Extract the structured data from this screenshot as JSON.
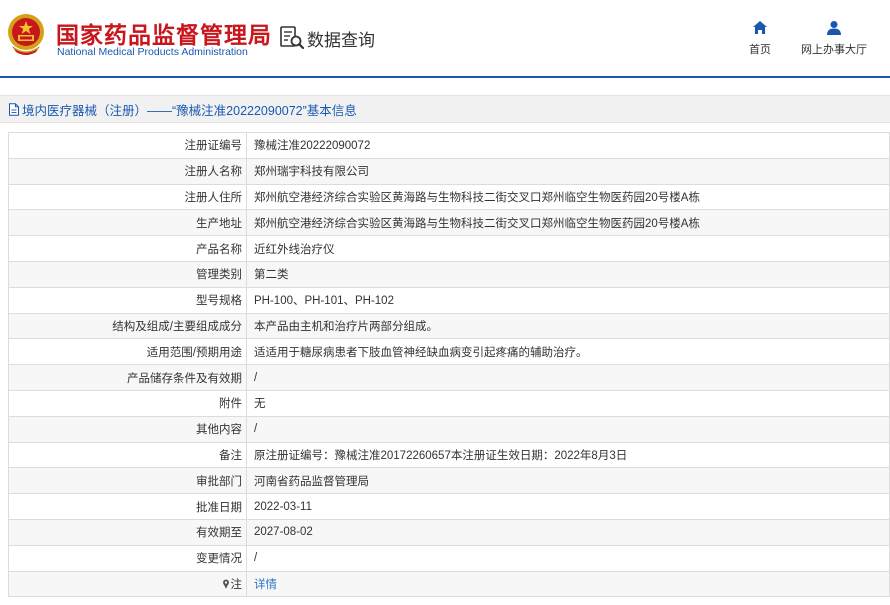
{
  "header": {
    "org_cn": "国家药品监督管理局",
    "org_en": "National Medical Products Administration",
    "query_label": "数据查询",
    "nav": [
      {
        "label": "首页",
        "icon": "home-icon"
      },
      {
        "label": "网上办事大厅",
        "icon": "user-icon"
      }
    ]
  },
  "breadcrumb": {
    "icon": "document-icon",
    "text": "境内医疗器械（注册）——“豫械注准20222090072”基本信息"
  },
  "colors": {
    "brand_red": "#c8161d",
    "brand_blue": "#1a58b0",
    "link_blue": "#2a74c6",
    "row_alt": "#f7f7f7"
  },
  "rows": [
    {
      "label": "注册证编号",
      "value": "豫械注准20222090072"
    },
    {
      "label": "注册人名称",
      "value": "郑州瑞宇科技有限公司"
    },
    {
      "label": "注册人住所",
      "value": "郑州航空港经济综合实验区黄海路与生物科技二街交叉口郑州临空生物医药园20号楼A栋"
    },
    {
      "label": "生产地址",
      "value": "郑州航空港经济综合实验区黄海路与生物科技二街交叉口郑州临空生物医药园20号楼A栋"
    },
    {
      "label": "产品名称",
      "value": "近红外线治疗仪"
    },
    {
      "label": "管理类别",
      "value": "第二类"
    },
    {
      "label": "型号规格",
      "value": "PH-100、PH-101、PH-102"
    },
    {
      "label": "结构及组成/主要组成成分",
      "value": "本产品由主机和治疗片两部分组成。"
    },
    {
      "label": "适用范围/预期用途",
      "value": "适适用于糖尿病患者下肢血管神经缺血病变引起疼痛的辅助治疗。"
    },
    {
      "label": "产品储存条件及有效期",
      "value": "/"
    },
    {
      "label": "附件",
      "value": "无"
    },
    {
      "label": "其他内容",
      "value": "/"
    },
    {
      "label": "备注",
      "value": "原注册证编号：豫械注准20172260657本注册证生效日期：2022年8月3日"
    },
    {
      "label": "审批部门",
      "value": "河南省药品监督管理局"
    },
    {
      "label": "批准日期",
      "value": "2022-03-11"
    },
    {
      "label": "有效期至",
      "value": "2027-08-02"
    },
    {
      "label": "变更情况",
      "value": "/"
    }
  ],
  "note_row": {
    "label": "注",
    "icon": "pin-icon",
    "link": "详情"
  }
}
